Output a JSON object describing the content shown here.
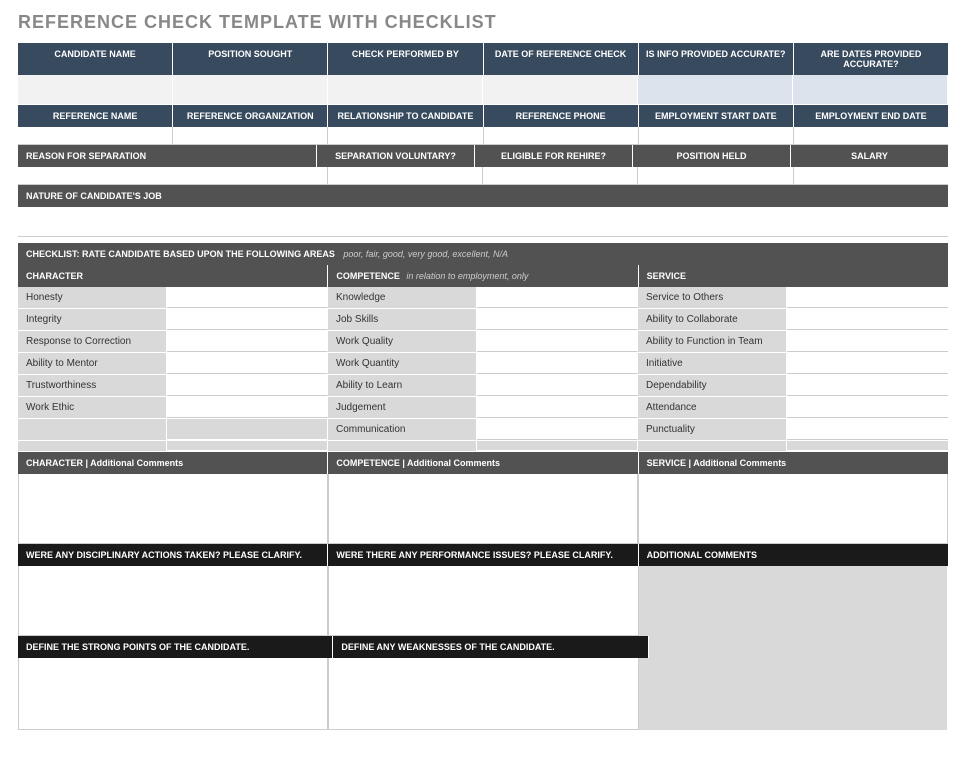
{
  "title": "REFERENCE CHECK TEMPLATE WITH CHECKLIST",
  "section1": {
    "headers": [
      "CANDIDATE NAME",
      "POSITION SOUGHT",
      "CHECK PERFORMED BY",
      "DATE OF REFERENCE CHECK",
      "IS INFO PROVIDED ACCURATE?",
      "ARE DATES PROVIDED ACCURATE?"
    ]
  },
  "section2": {
    "headers": [
      "REFERENCE NAME",
      "REFERENCE ORGANIZATION",
      "RELATIONSHIP TO CANDIDATE",
      "REFERENCE PHONE",
      "EMPLOYMENT START DATE",
      "EMPLOYMENT END DATE"
    ]
  },
  "section3": {
    "reason": "REASON FOR SEPARATION",
    "headers": [
      "SEPARATION VOLUNTARY?",
      "ELIGIBLE FOR REHIRE?",
      "POSITION HELD",
      "SALARY"
    ]
  },
  "nature": "NATURE OF CANDIDATE'S JOB",
  "checklist": {
    "title": "CHECKLIST: RATE CANDIDATE BASED UPON THE FOLLOWING AREAS",
    "hint": "poor, fair, good, very good, excellent, N/A",
    "cols": {
      "character": {
        "label": "CHARACTER",
        "items": [
          "Honesty",
          "Integrity",
          "Response to Correction",
          "Ability to Mentor",
          "Trustworthiness",
          "Work Ethic",
          "",
          ""
        ]
      },
      "competence": {
        "label": "COMPETENCE",
        "hint": "in relation to employment, only",
        "items": [
          "Knowledge",
          "Job Skills",
          "Work Quality",
          "Work Quantity",
          "Ability to Learn",
          "Judgement",
          "Communication",
          ""
        ]
      },
      "service": {
        "label": "SERVICE",
        "items": [
          "Service to Others",
          "Ability to Collaborate",
          "Ability to Function in Team",
          "Initiative",
          "Dependability",
          "Attendance",
          "Punctuality",
          ""
        ]
      }
    },
    "comments": {
      "character": "CHARACTER  |  Additional Comments",
      "competence": "COMPETENCE  |  Additional Comments",
      "service": "SERVICE  |  Additional Comments"
    }
  },
  "ext": {
    "disc": "WERE ANY DISCIPLINARY ACTIONS TAKEN? PLEASE CLARIFY.",
    "perf": "WERE THERE ANY PERFORMANCE ISSUES? PLEASE CLARIFY.",
    "addl": "ADDITIONAL COMMENTS",
    "strong": "DEFINE THE STRONG POINTS OF THE CANDIDATE.",
    "weak": "DEFINE ANY WEAKNESSES OF THE CANDIDATE."
  }
}
